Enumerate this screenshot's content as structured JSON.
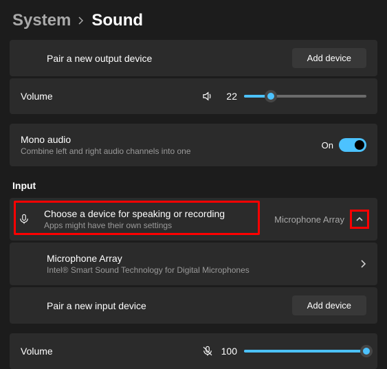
{
  "breadcrumb": {
    "parent": "System",
    "current": "Sound"
  },
  "output": {
    "pair": {
      "title": "Pair a new output device",
      "button": "Add device"
    },
    "volume": {
      "label": "Volume",
      "value": "22",
      "percent": 22
    },
    "mono": {
      "title": "Mono audio",
      "sub": "Combine left and right audio channels into one",
      "state": "On"
    }
  },
  "input_section_label": "Input",
  "input": {
    "choose": {
      "title": "Choose a device for speaking or recording",
      "sub": "Apps might have their own settings",
      "selected": "Microphone Array"
    },
    "device": {
      "title": "Microphone Array",
      "sub": "Intel® Smart Sound Technology for Digital Microphones"
    },
    "pair": {
      "title": "Pair a new input device",
      "button": "Add device"
    },
    "volume": {
      "label": "Volume",
      "value": "100",
      "percent": 100
    }
  }
}
